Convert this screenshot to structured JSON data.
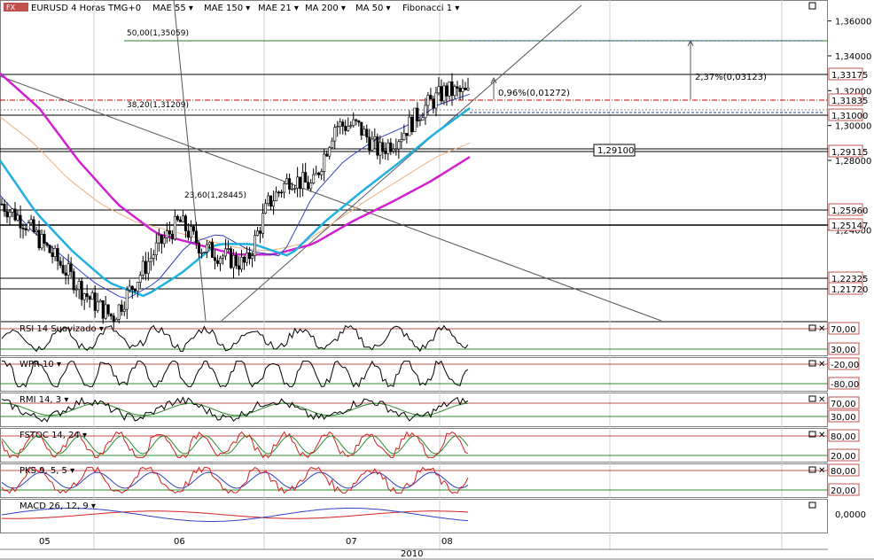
{
  "header": {
    "symbol_title": "EURUSD 4 Horas TMG+0",
    "indicators": [
      {
        "label": "MAE 55",
        "color": "#d01010"
      },
      {
        "label": "MAE 150",
        "color": "#e89a30"
      },
      {
        "label": "MAE 21",
        "color": "#3040c0"
      },
      {
        "label": "MA 200",
        "color": "#d020d0"
      },
      {
        "label": "MA 50",
        "color": "#20a0d0"
      },
      {
        "label": "Fibonacci 1",
        "color": "#000000"
      }
    ]
  },
  "annotations": {
    "fib_50": "50,00(1,35059)",
    "fib_382": "38,20(1,31209)",
    "fib_236": "23,60(1,28445)",
    "measure_pct_1": "0,96%(0,01272)",
    "measure_pct_2": "2,37%(0,03123)",
    "level_box": "1,29100"
  },
  "price_axis": {
    "ticks": [
      "1,36000",
      "1,34000",
      "1,32000",
      "1,30000",
      "1,28000",
      "1,24000"
    ],
    "tagged_levels": [
      "1,33175",
      "1,31835",
      "1,31000",
      "1,29115",
      "1,25960",
      "1,25147",
      "1,22325",
      "1,21720"
    ]
  },
  "sub_panels": [
    {
      "label": "RSI 14 Suavizado",
      "upper": "70,00",
      "lower": "30,00"
    },
    {
      "label": "WPR 10",
      "upper": "-20,00",
      "lower": "-80,00"
    },
    {
      "label": "RMI 14, 3",
      "upper": "70,00",
      "lower": "30,00"
    },
    {
      "label": "FSTOC 14, 24",
      "upper": "80,00",
      "lower": "20,00"
    },
    {
      "label": "PKS 9, 5, 5",
      "upper": "80,00",
      "lower": "20,00"
    },
    {
      "label": "MACD 26, 12, 9",
      "upper": "",
      "lower": "",
      "zero": "0,0000"
    }
  ],
  "time_axis": {
    "months": [
      "05",
      "06",
      "07",
      "08"
    ],
    "year": "2010"
  },
  "chart_data": {
    "type": "line",
    "title": "EURUSD 4 Horas TMG+0",
    "x": [
      "05",
      "06",
      "07",
      "08"
    ],
    "ylim": [
      1.19,
      1.37
    ],
    "series": [
      {
        "name": "EURUSD",
        "approx_path": [
          1.255,
          1.245,
          1.23,
          1.215,
          1.2,
          1.19,
          1.21,
          1.23,
          1.245,
          1.23,
          1.225,
          1.22,
          1.255,
          1.27,
          1.265,
          1.3,
          1.3,
          1.285,
          1.295,
          1.31,
          1.32,
          1.318
        ]
      },
      {
        "name": "MA 200",
        "approx_path": [
          1.33,
          1.31,
          1.28,
          1.255,
          1.238,
          1.232,
          1.226,
          1.226,
          1.232,
          1.245,
          1.256,
          1.268,
          1.282
        ]
      },
      {
        "name": "MA 50",
        "approx_path": [
          1.28,
          1.25,
          1.228,
          1.21,
          1.202,
          1.215,
          1.232,
          1.232,
          1.225,
          1.245,
          1.262,
          1.278,
          1.295,
          1.31
        ]
      }
    ],
    "horizontal_levels": [
      1.33175,
      1.31835,
      1.31,
      1.29115,
      1.2596,
      1.25147,
      1.22325,
      1.2172
    ]
  }
}
